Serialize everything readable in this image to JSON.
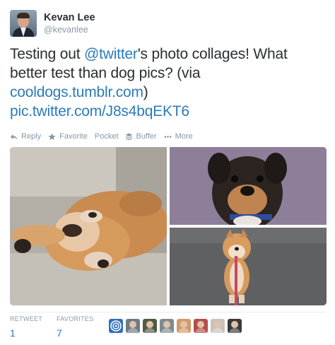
{
  "user": {
    "full_name": "Kevan Lee",
    "screen_name": "@kevanlee"
  },
  "tweet": {
    "text_intro": "Testing out ",
    "mention": "@twitter",
    "text_mid": "'s photo collages! What better test than dog pics? (via ",
    "link": "cooldogs.tumblr.com",
    "text_close": ")",
    "pic_link": "pic.twitter.com/J8s4bqEKT6"
  },
  "actions": {
    "reply": "Reply",
    "favorite": "Favorite",
    "pocket": "Pocket",
    "buffer": "Buffer",
    "more": "More"
  },
  "media": {
    "photos": [
      {
        "description": "sleeping-dog-on-couch"
      },
      {
        "description": "dog-purple-background"
      },
      {
        "description": "shiba-on-leash"
      }
    ]
  },
  "stats": {
    "retweets_label": "RETWEET",
    "retweets_value": "1",
    "favorites_label": "FAVORITES",
    "favorites_value": "7"
  },
  "favoriters": [
    {
      "icon": "swirl-avatar",
      "color": "#2f6fc1"
    },
    {
      "icon": "person-avatar",
      "color": "#6c7b86"
    },
    {
      "icon": "person-avatar",
      "color": "#4e5b46"
    },
    {
      "icon": "person-avatar",
      "color": "#7d8a8f"
    },
    {
      "icon": "person-avatar",
      "color": "#d19b6b"
    },
    {
      "icon": "person-avatar",
      "color": "#b34e4a"
    },
    {
      "icon": "person-avatar",
      "color": "#c8c2bd"
    },
    {
      "icon": "person-avatar",
      "color": "#3a3a3a"
    }
  ],
  "colors": {
    "link": "#2b7bb9",
    "muted": "#8899a6",
    "text": "#292f33"
  }
}
